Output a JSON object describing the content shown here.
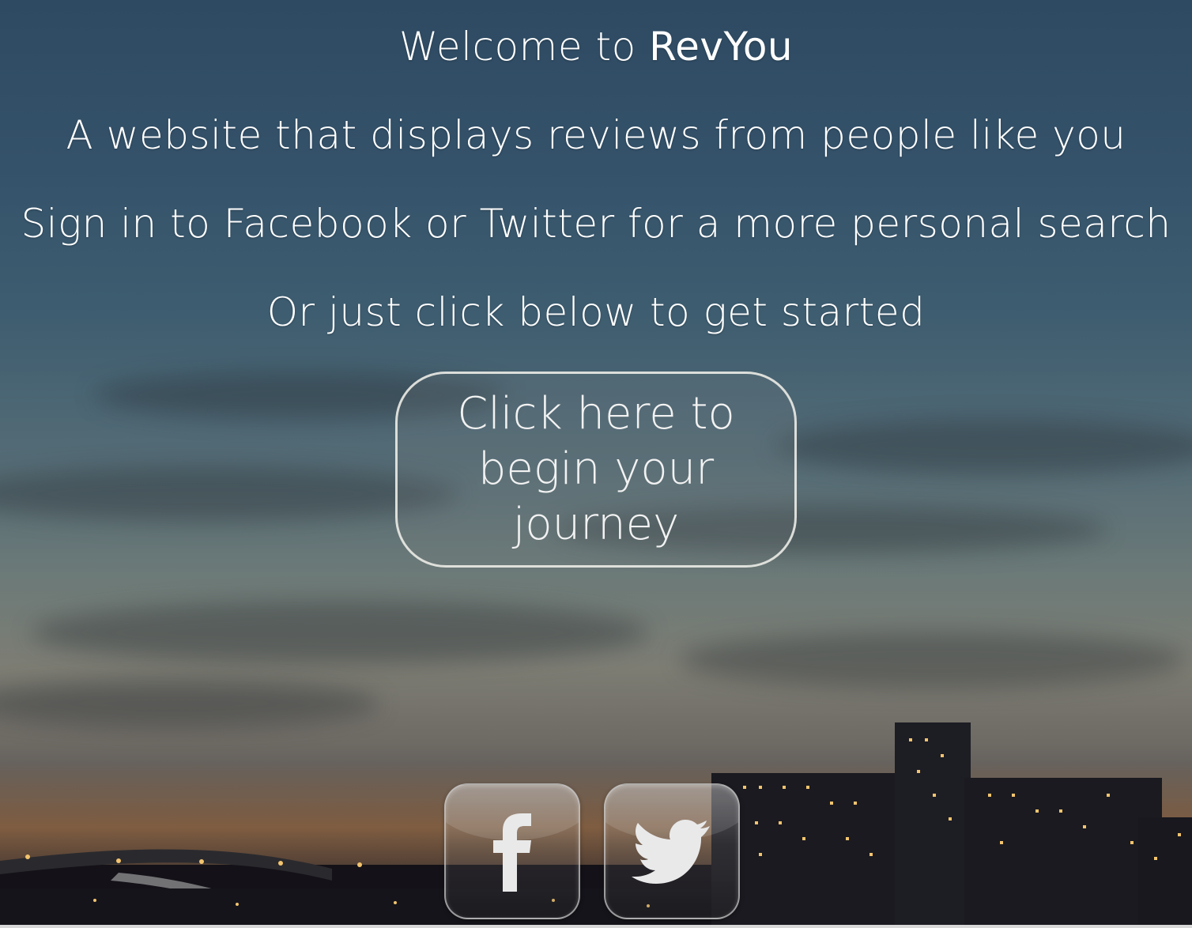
{
  "header": {
    "welcome_prefix": "Welcome to",
    "brand": "RevYou",
    "tagline": "A website that displays reviews from people like you",
    "signin_text": "Sign in to Facebook or Twitter for a more personal search",
    "start_text": "Or just click below to get started"
  },
  "cta": {
    "label": "Click here to begin your journey"
  },
  "social": {
    "facebook_icon": "facebook-icon",
    "twitter_icon": "twitter-icon"
  }
}
